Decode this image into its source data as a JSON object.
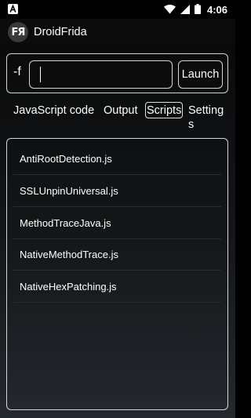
{
  "status_bar": {
    "notification_icon": "a-app-icon",
    "wifi_icon": "wifi-icon",
    "signal_icon": "signal-icon",
    "battery_icon": "battery-icon",
    "time": "4:06"
  },
  "app_bar": {
    "logo_text": "FЯ",
    "title": "DroidFrida"
  },
  "top_panel": {
    "flag_label": "-f",
    "script_input_value": "",
    "launch_label": "Launch"
  },
  "tabs": [
    {
      "label": "JavaScript code",
      "selected": false
    },
    {
      "label": "Output",
      "selected": false
    },
    {
      "label": "Scripts",
      "selected": true
    },
    {
      "label": "Settings",
      "selected": false
    }
  ],
  "scripts": [
    {
      "name": "AntiRootDetection.js"
    },
    {
      "name": "SSLUnpinUniversal.js"
    },
    {
      "name": "MethodTraceJava.js"
    },
    {
      "name": "NativeMethodTrace.js"
    },
    {
      "name": "NativeHexPatching.js"
    }
  ],
  "colors": {
    "border": "#d6d6d6",
    "background_top": "#0a0a0a",
    "background_bottom": "#24292e",
    "app_bar": "#0b0b0b",
    "text": "#ffffff"
  }
}
